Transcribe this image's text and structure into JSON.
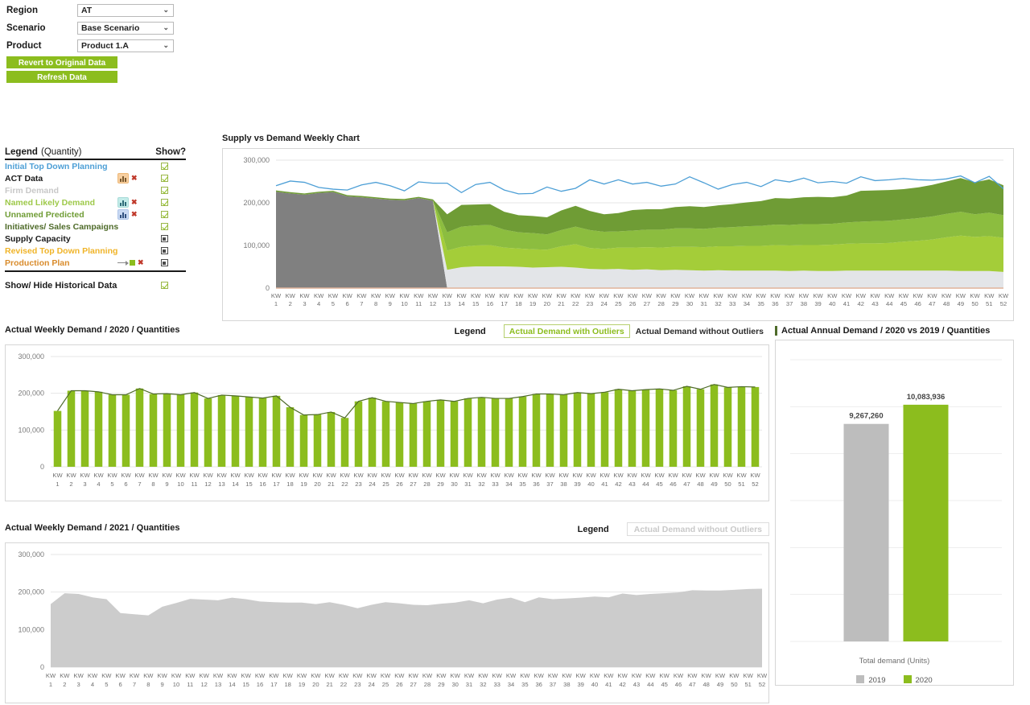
{
  "filters": {
    "rows": [
      {
        "label": "Region",
        "value": "AT"
      },
      {
        "label": "Scenario",
        "value": "Base Scenario"
      },
      {
        "label": "Product",
        "value": "Product 1.A"
      }
    ],
    "caret": "⌄"
  },
  "buttons": {
    "revert": "Revert to Original Data",
    "refresh": "Refresh Data"
  },
  "legend_panel": {
    "header": {
      "legend": "Legend",
      "quantity": "(Quantity)",
      "show": "Show?"
    },
    "rows": [
      {
        "label": "Initial Top Down Planning",
        "color": "#4d9fd6",
        "icon": null,
        "delete": false,
        "check": "green"
      },
      {
        "label": "ACT Data",
        "color": "#1a1a1a",
        "icon": "orange",
        "delete": true,
        "check": "green"
      },
      {
        "label": "Firm Demand",
        "color": "#c8c8c8",
        "icon": null,
        "delete": false,
        "check": "green"
      },
      {
        "label": "Named Likely Demand",
        "color": "#9ec94a",
        "icon": "teal",
        "delete": true,
        "check": "green"
      },
      {
        "label": "Unnamed Predicted",
        "color": "#6f9c35",
        "icon": "blue",
        "delete": true,
        "check": "green"
      },
      {
        "label": "Initiatives/ Sales Campaigns",
        "color": "#4f6b2a",
        "icon": null,
        "delete": false,
        "check": "green"
      },
      {
        "label": "Supply Capacity",
        "color": "#1a1a1a",
        "icon": null,
        "delete": false,
        "check": "dark"
      },
      {
        "label": "Revised Top Down Planning",
        "color": "#f0b429",
        "icon": null,
        "delete": false,
        "check": "dark"
      },
      {
        "label": "Production Plan",
        "color": "#d98b2b",
        "icon": "arrow",
        "delete": true,
        "check": "dark"
      }
    ],
    "delete_glyph": "✖",
    "footer": {
      "label": "Show/ Hide Historical Data",
      "check": "green"
    }
  },
  "supply_panel": {
    "title": "Supply vs Demand Weekly Chart"
  },
  "wd2020_panel": {
    "title": "Actual Weekly Demand / 2020 / Quantities",
    "legend_word": "Legend",
    "btn_with": "Actual Demand with Outliers",
    "btn_without": "Actual Demand without Outliers"
  },
  "wd2021_panel": {
    "title": "Actual Weekly Demand / 2021 / Quantities",
    "legend_word": "Legend",
    "btn_without": "Actual Demand without Outliers"
  },
  "annual_panel": {
    "title": "Actual Annual Demand / 2020 vs 2019 / Quantities",
    "axis_label": "Total demand (Units)",
    "legend": [
      {
        "label": "2019",
        "color": "#bdbdbd"
      },
      {
        "label": "2020",
        "color": "#8cbd1e"
      }
    ]
  },
  "chart_data": [
    {
      "id": "supply_vs_demand",
      "type": "area",
      "title": "Supply vs Demand Weekly Chart",
      "xlabel": "",
      "ylabel": "",
      "ylim": [
        0,
        300000
      ],
      "yticks": [
        0,
        100000,
        200000,
        300000
      ],
      "ytick_labels": [
        "0",
        "100,000",
        "200,000",
        "300,000"
      ],
      "grid": true,
      "legend_position": "external-left",
      "x_prefix": "KW",
      "x": [
        1,
        2,
        3,
        4,
        5,
        6,
        7,
        8,
        9,
        10,
        11,
        12,
        13,
        14,
        15,
        16,
        17,
        18,
        19,
        20,
        21,
        22,
        23,
        24,
        25,
        26,
        27,
        28,
        29,
        30,
        31,
        32,
        33,
        34,
        35,
        36,
        37,
        38,
        39,
        40,
        41,
        42,
        43,
        44,
        45,
        46,
        47,
        48,
        49,
        50,
        51,
        52
      ],
      "series": [
        {
          "name": "ACT Data",
          "stacked": true,
          "color": "#808080",
          "values": [
            226000,
            222000,
            219000,
            223000,
            225000,
            215000,
            213000,
            210000,
            207000,
            206000,
            211000,
            205000,
            0,
            0,
            0,
            0,
            0,
            0,
            0,
            0,
            0,
            0,
            0,
            0,
            0,
            0,
            0,
            0,
            0,
            0,
            0,
            0,
            0,
            0,
            0,
            0,
            0,
            0,
            0,
            0,
            0,
            0,
            0,
            0,
            0,
            0,
            0,
            0,
            0,
            0,
            0,
            0
          ]
        },
        {
          "name": "Firm Demand",
          "stacked": true,
          "color": "#e3e5e8",
          "values": [
            0,
            0,
            0,
            0,
            0,
            0,
            0,
            0,
            0,
            0,
            0,
            0,
            43000,
            49000,
            51000,
            51000,
            51000,
            50000,
            48000,
            49000,
            50000,
            48000,
            45000,
            44000,
            45000,
            43000,
            44000,
            42000,
            43000,
            42000,
            41000,
            42000,
            41000,
            41000,
            41000,
            41000,
            40000,
            41000,
            40000,
            40000,
            41000,
            41000,
            41000,
            41000,
            41000,
            41000,
            41000,
            41000,
            40000,
            40000,
            40000,
            38000
          ]
        },
        {
          "name": "Named Likely Demand",
          "stacked": true,
          "color": "#a4cd39",
          "values": [
            0,
            0,
            0,
            0,
            0,
            0,
            0,
            0,
            0,
            0,
            0,
            0,
            45000,
            48000,
            49000,
            50000,
            44000,
            43000,
            43000,
            41000,
            48000,
            55000,
            49000,
            48000,
            50000,
            52000,
            52000,
            53000,
            54000,
            55000,
            55000,
            56000,
            57000,
            58000,
            58000,
            60000,
            60000,
            60000,
            61000,
            62000,
            63000,
            64000,
            64000,
            65000,
            68000,
            70000,
            73000,
            78000,
            83000,
            80000,
            82000,
            80000
          ]
        },
        {
          "name": "Unnamed Predicted",
          "stacked": true,
          "color": "#8cbd3f",
          "values": [
            0,
            0,
            0,
            0,
            0,
            0,
            0,
            0,
            0,
            0,
            0,
            0,
            43000,
            47000,
            47000,
            47000,
            42000,
            38000,
            38000,
            36000,
            38000,
            41000,
            42000,
            40000,
            38000,
            40000,
            41000,
            42000,
            43000,
            43000,
            43000,
            44000,
            45000,
            46000,
            47000,
            48000,
            48000,
            49000,
            49000,
            49000,
            50000,
            51000,
            52000,
            52000,
            52000,
            53000,
            54000,
            55000,
            56000,
            53000,
            55000,
            53000
          ]
        },
        {
          "name": "Initiatives/ Sales Campaigns",
          "stacked": true,
          "color": "#6f9c35",
          "values": [
            3000,
            3000,
            3000,
            3000,
            3000,
            3000,
            3000,
            3000,
            3000,
            3000,
            3000,
            3000,
            42000,
            51000,
            49000,
            49000,
            42000,
            40000,
            40000,
            40000,
            46000,
            49000,
            45000,
            41000,
            43000,
            48000,
            48000,
            48000,
            50000,
            52000,
            51000,
            52000,
            54000,
            56000,
            58000,
            62000,
            62000,
            63000,
            64000,
            62000,
            63000,
            72000,
            72000,
            72000,
            71000,
            72000,
            74000,
            76000,
            79000,
            75000,
            78000,
            70000
          ]
        },
        {
          "name": "Supply Capacity",
          "stacked": false,
          "type": "line",
          "color": "#4d9fd6",
          "values": [
            240000,
            251000,
            248000,
            236000,
            232000,
            230000,
            242000,
            248000,
            240000,
            228000,
            249000,
            246000,
            246000,
            224000,
            243000,
            248000,
            230000,
            221000,
            222000,
            237000,
            227000,
            234000,
            254000,
            244000,
            254000,
            244000,
            248000,
            239000,
            244000,
            261000,
            247000,
            232000,
            243000,
            248000,
            238000,
            254000,
            249000,
            258000,
            247000,
            250000,
            246000,
            261000,
            252000,
            254000,
            257000,
            254000,
            253000,
            256000,
            263000,
            247000,
            262000,
            233000
          ]
        }
      ]
    },
    {
      "id": "weekly_demand_2020",
      "type": "bar",
      "title": "Actual Weekly Demand / 2020 / Quantities",
      "xlabel": "",
      "ylabel": "",
      "ylim": [
        0,
        300000
      ],
      "yticks": [
        0,
        100000,
        200000,
        300000
      ],
      "ytick_labels": [
        "0",
        "100,000",
        "200,000",
        "300,000"
      ],
      "grid": true,
      "bar_color": "#8cbd1e",
      "line_color": "#4f6b2a",
      "x_prefix": "KW",
      "categories": [
        1,
        2,
        3,
        4,
        5,
        6,
        7,
        8,
        9,
        10,
        11,
        12,
        13,
        14,
        15,
        16,
        17,
        18,
        19,
        20,
        21,
        22,
        23,
        24,
        25,
        26,
        27,
        28,
        29,
        30,
        31,
        32,
        33,
        34,
        35,
        36,
        37,
        38,
        39,
        40,
        41,
        42,
        43,
        44,
        45,
        46,
        47,
        48,
        49,
        50,
        51,
        52
      ],
      "values": [
        152000,
        207000,
        207000,
        204000,
        196000,
        196000,
        213000,
        198000,
        199000,
        196000,
        202000,
        186000,
        195000,
        193000,
        190000,
        187000,
        193000,
        162000,
        141000,
        142000,
        149000,
        133000,
        178000,
        188000,
        178000,
        175000,
        172000,
        178000,
        182000,
        178000,
        186000,
        189000,
        186000,
        186000,
        191000,
        198000,
        198000,
        196000,
        202000,
        199000,
        203000,
        211000,
        207000,
        210000,
        212000,
        208000,
        219000,
        211000,
        224000,
        216000,
        218000,
        217000
      ]
    },
    {
      "id": "weekly_demand_2021",
      "type": "area",
      "title": "Actual Weekly Demand / 2021 / Quantities",
      "xlabel": "",
      "ylabel": "",
      "ylim": [
        0,
        300000
      ],
      "yticks": [
        0,
        100000,
        200000,
        300000
      ],
      "ytick_labels": [
        "0",
        "100,000",
        "200,000",
        "300,000"
      ],
      "grid": true,
      "area_color": "#cccccc",
      "x_prefix": "KW",
      "categories": [
        1,
        2,
        3,
        4,
        5,
        6,
        7,
        8,
        9,
        10,
        11,
        12,
        13,
        14,
        15,
        16,
        17,
        18,
        19,
        20,
        21,
        22,
        23,
        24,
        25,
        26,
        27,
        28,
        29,
        30,
        31,
        32,
        33,
        34,
        35,
        36,
        37,
        38,
        39,
        40,
        41,
        42,
        43,
        44,
        45,
        46,
        47,
        48,
        49,
        50,
        51,
        52
      ],
      "values": [
        168000,
        197000,
        195000,
        186000,
        181000,
        144000,
        141000,
        138000,
        161000,
        171000,
        182000,
        180000,
        178000,
        185000,
        181000,
        175000,
        173000,
        172000,
        172000,
        168000,
        173000,
        166000,
        157000,
        166000,
        173000,
        170000,
        166000,
        165000,
        169000,
        172000,
        178000,
        170000,
        180000,
        185000,
        173000,
        186000,
        181000,
        183000,
        185000,
        188000,
        186000,
        196000,
        192000,
        195000,
        197000,
        199000,
        205000,
        204000,
        204000,
        206000,
        208000,
        209000
      ]
    },
    {
      "id": "annual_demand_2020_vs_2019",
      "type": "bar",
      "title": "Actual Annual Demand / 2020 vs 2019 / Quantities",
      "xlabel": "Total demand (Units)",
      "ylabel": "",
      "ylim": [
        0,
        12000000
      ],
      "grid": true,
      "categories": [
        "2019",
        "2020"
      ],
      "values": [
        9267260,
        10083936
      ],
      "value_labels": [
        "9,267,260",
        "10,083,936"
      ],
      "colors": [
        "#bdbdbd",
        "#8cbd1e"
      ]
    }
  ]
}
